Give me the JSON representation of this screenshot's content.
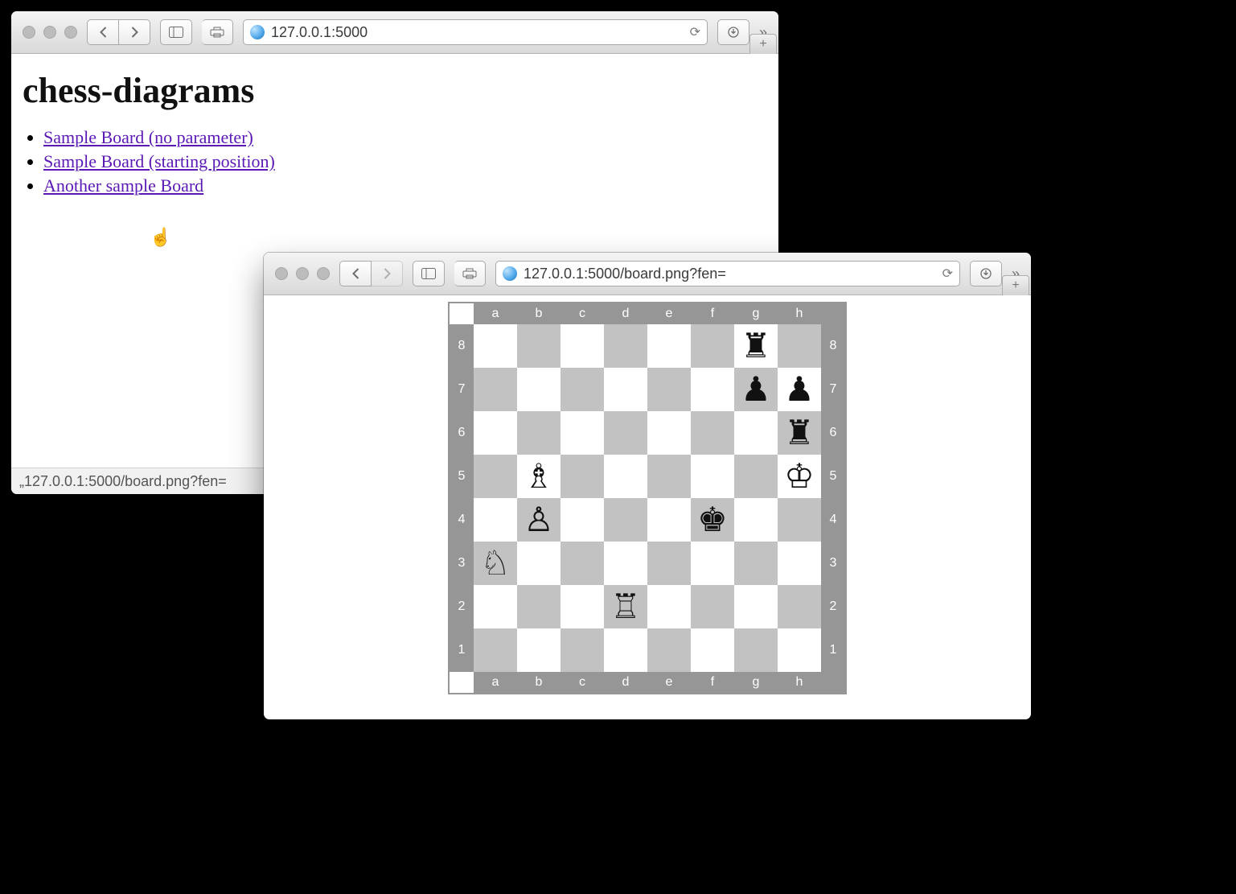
{
  "window1": {
    "url": "127.0.0.1:5000",
    "page_title": "chess-diagrams",
    "links": [
      "Sample Board (no parameter)",
      "Sample Board (starting position)",
      "Another sample Board"
    ],
    "status": "„127.0.0.1:5000/board.png?fen="
  },
  "window2": {
    "url": "127.0.0.1:5000/board.png?fen=",
    "files": [
      "a",
      "b",
      "c",
      "d",
      "e",
      "f",
      "g",
      "h"
    ],
    "ranks": [
      "8",
      "7",
      "6",
      "5",
      "4",
      "3",
      "2",
      "1"
    ],
    "position": {
      "g8": "r",
      "g7": "p",
      "h7": "p",
      "h6": "r",
      "b5": "B",
      "h5": "K",
      "b4": "P",
      "f4": "k",
      "a3": "N",
      "d2": "R"
    },
    "glyphs": {
      "K": "♔",
      "Q": "♕",
      "R": "♖",
      "B": "♗",
      "N": "♘",
      "P": "♙",
      "k": "♚",
      "q": "♛",
      "r": "♜",
      "b": "♝",
      "n": "♞",
      "p": "♟"
    }
  }
}
